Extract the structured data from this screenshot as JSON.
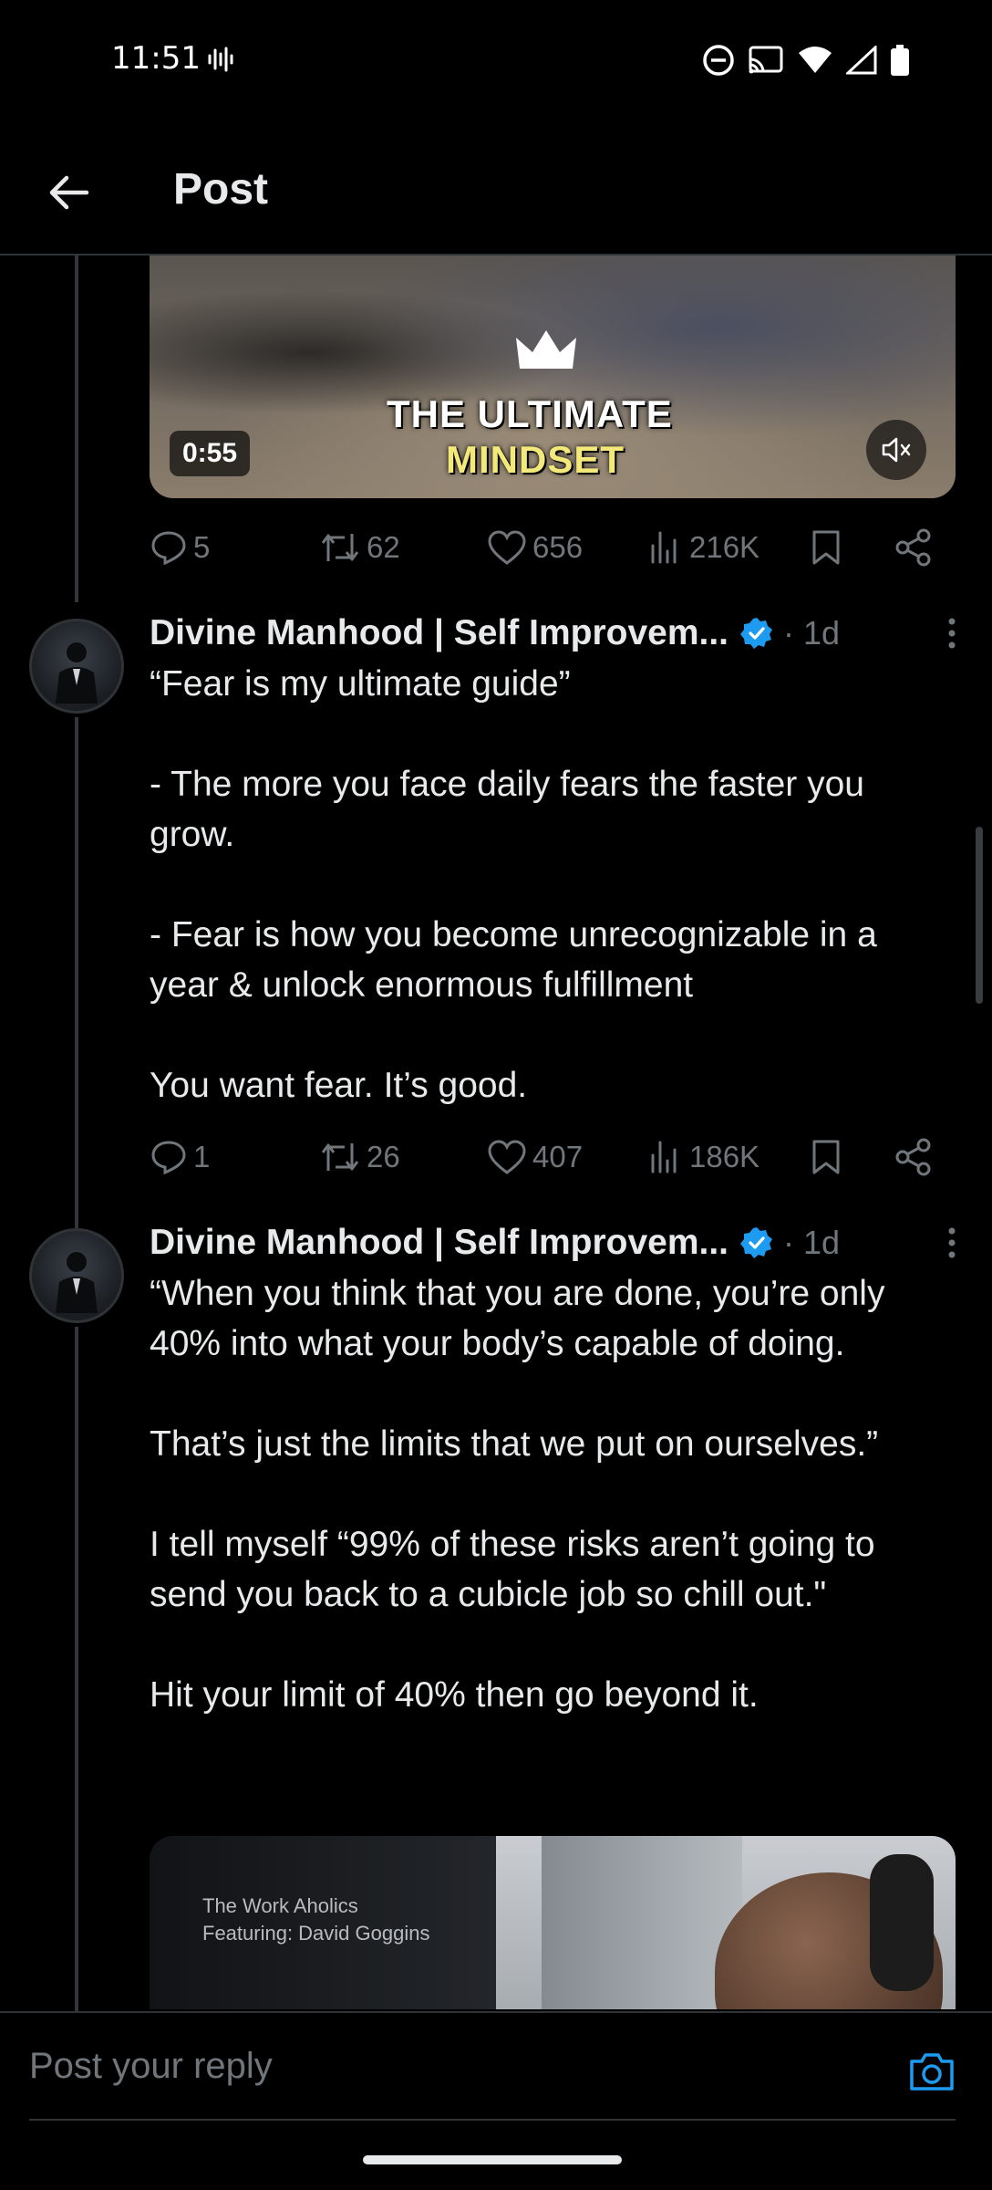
{
  "status_bar": {
    "time": "11:51",
    "icons": [
      "voice-activity-icon",
      "dnd-icon",
      "cast-icon",
      "wifi-icon",
      "signal-icon",
      "battery-icon"
    ]
  },
  "header": {
    "title": "Post"
  },
  "video": {
    "caption_line1": "THE ULTIMATE",
    "caption_line2": "MINDSET",
    "duration": "0:55"
  },
  "posts": [
    {
      "stats": {
        "replies": "5",
        "retweets": "62",
        "likes": "656",
        "views": "216K"
      }
    },
    {
      "author": "Divine Manhood | Self Improvem...",
      "time": "· 1d",
      "text": "“Fear is my ultimate guide”\n\n- The more you face daily fears the faster you grow.\n\n- Fear is how you become unrecognizable in a year & unlock enormous fulfillment\n\nYou want fear. It’s good.",
      "stats": {
        "replies": "1",
        "retweets": "26",
        "likes": "407",
        "views": "186K"
      }
    },
    {
      "author": "Divine Manhood | Self Improvem...",
      "time": "· 1d",
      "text": "“When you think that you are done, you’re only 40% into what your body’s capable of doing.\n\nThat’s just the limits that we put on ourselves.”\n\nI tell myself “99% of these risks aren’t going to send you back to a cubicle job so chill out.\"\n\nHit your limit of 40% then go beyond it.",
      "media_text_line1": "The Work Aholics",
      "media_text_line2": "Featuring: David Goggins"
    }
  ],
  "reply": {
    "placeholder": "Post your reply"
  },
  "colors": {
    "background": "#000000",
    "text": "#e7e9ea",
    "muted": "#71767b",
    "accent": "#1d9bf0",
    "divider": "#2f3336"
  }
}
